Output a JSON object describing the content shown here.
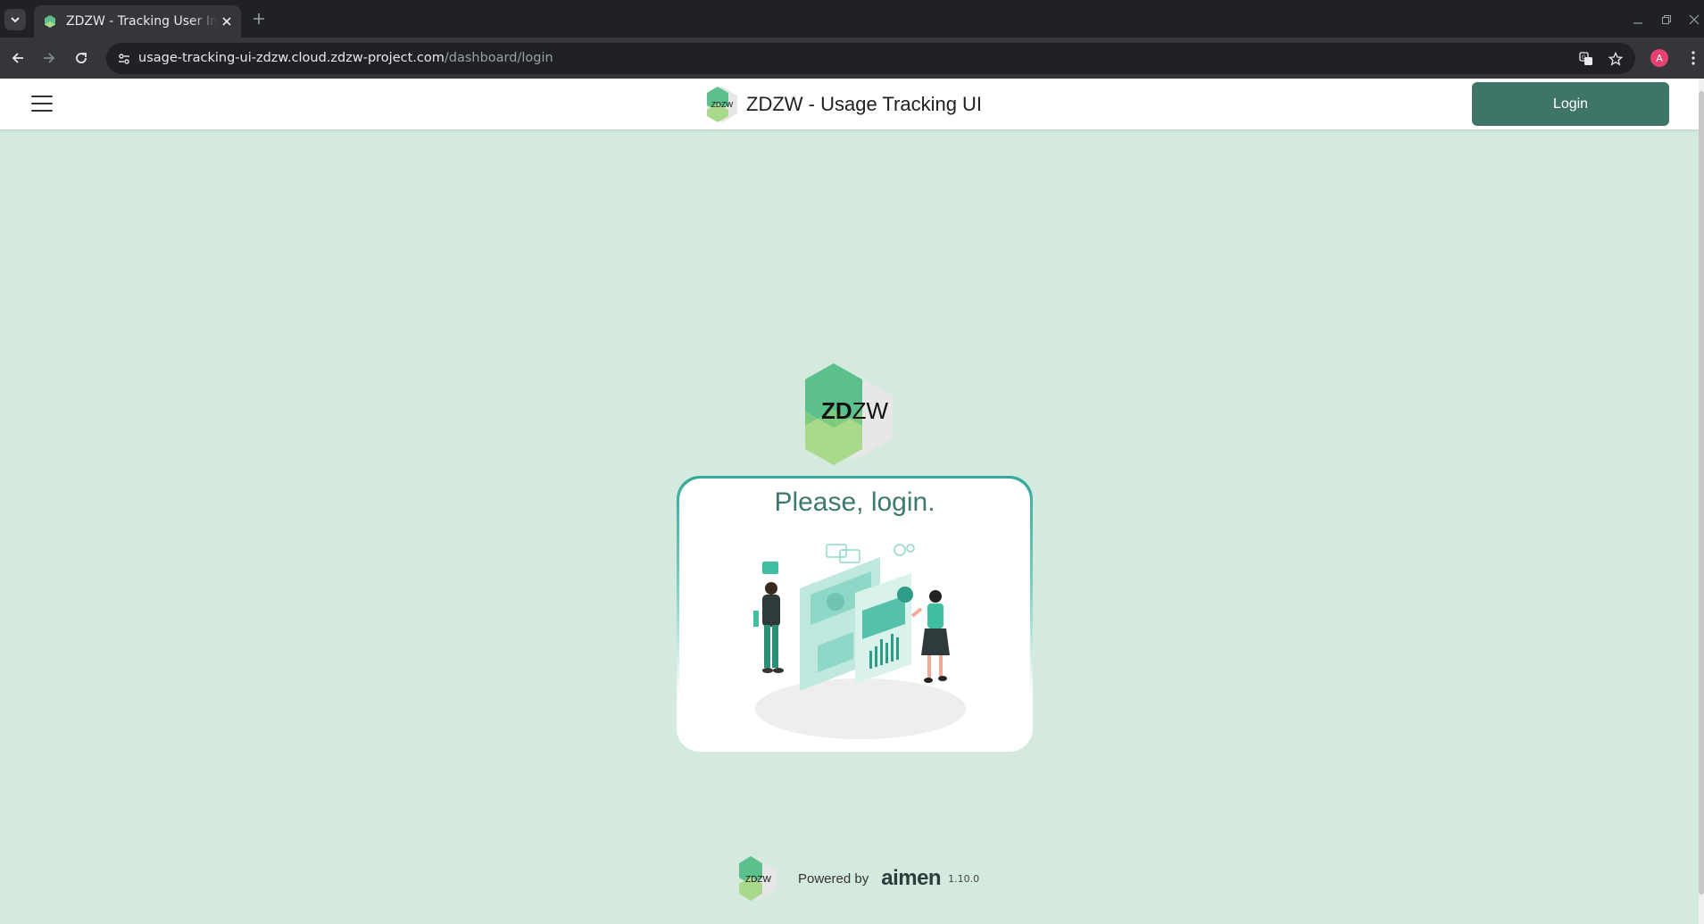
{
  "browser": {
    "tab_title": "ZDZW - Tracking User Interface",
    "url_host": "usage-tracking-ui-zdzw.cloud.zdzw-project.com",
    "url_path": "/dashboard/login",
    "profile_initial": "A"
  },
  "header": {
    "logo_text": "ZDZW",
    "title": "ZDZW - Usage Tracking UI",
    "login_label": "Login"
  },
  "main": {
    "logo_bold": "ZD",
    "logo_light": "ZW",
    "card_title": "Please, login."
  },
  "footer": {
    "logo_text": "ZDZW",
    "powered_by": "Powered by",
    "brand": "aimen",
    "version": "1.10.0"
  },
  "colors": {
    "page_background": "#d4eadf",
    "primary_button": "#3f7569",
    "card_title": "#3c7a6e",
    "logo_green": "#5cc08d",
    "logo_light_green": "#a9d98a"
  }
}
